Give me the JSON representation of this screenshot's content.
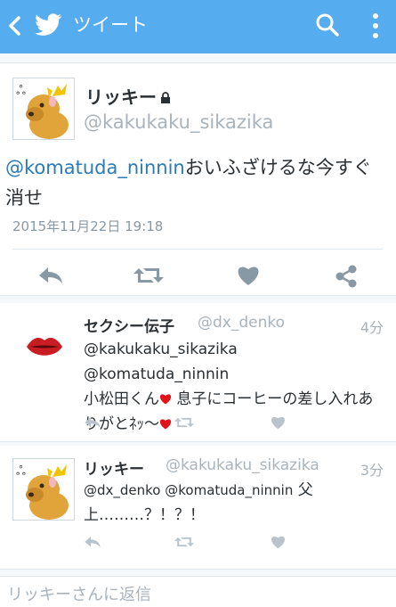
{
  "appbar": {
    "title": "ツイート",
    "color": "#55acee"
  },
  "tweet": {
    "name": "リッキー",
    "handle": "@kakukaku_sikazika",
    "mention": "@komatuda_ninnin",
    "text": "おいふざけるな今すぐ消せ",
    "date": "2015年11月22日 19:18",
    "avatar": "deer-cartoon-avatar"
  },
  "actions": [
    "reply-icon",
    "retweet-icon",
    "like-icon",
    "share-icon"
  ],
  "replies": [
    {
      "name": "セクシー伝子",
      "handle": "@dx_denko",
      "time": "4分",
      "mentions": "@kakukaku_sikazika @komatuda_ninnin",
      "text_part1": "小松田くん",
      "text_part2": " 息子にコーヒーの差し入れありがとﾈｯ〜",
      "avatar": "red-lips-avatar"
    },
    {
      "name": "リッキー",
      "handle": "@kakukaku_sikazika",
      "time": "3分",
      "mentions": "@dx_denko @komatuda_ninnin",
      "text": " 父上………？！？！",
      "avatar": "deer-cartoon-avatar"
    }
  ],
  "compose": {
    "placeholder": "リッキーさんに返信"
  }
}
